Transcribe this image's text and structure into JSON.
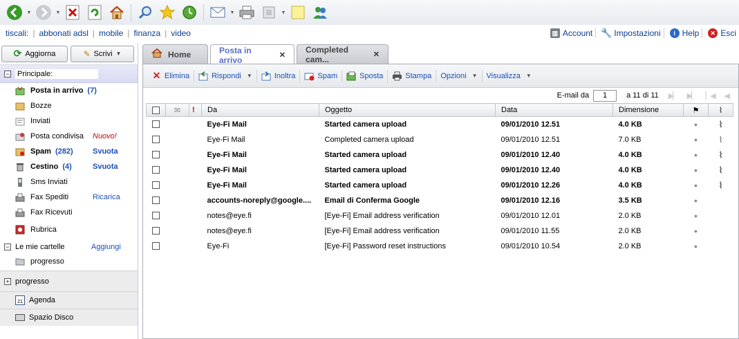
{
  "links": {
    "items": [
      "tiscali:",
      "abbonati adsl",
      "mobile",
      "finanza",
      "video"
    ],
    "account": "Account",
    "settings": "Impostazioni",
    "help": "Help",
    "exit": "Esci"
  },
  "sidebar": {
    "refresh_label": "Aggiorna",
    "compose_label": "Scrivi",
    "section_title": "Principale:",
    "folders": [
      {
        "label": "Posta in arrivo",
        "count": "(7)"
      },
      {
        "label": "Bozze"
      },
      {
        "label": "Inviati"
      },
      {
        "label": "Posta condivisa",
        "tag": "Nuovo!"
      },
      {
        "label": "Spam",
        "count": "(282)",
        "action": "Svuota"
      },
      {
        "label": "Cestino",
        "count": "(4)",
        "action": "Svuota"
      },
      {
        "label": "Sms Inviati"
      },
      {
        "label": "Fax Spediti",
        "action": "Ricarica"
      },
      {
        "label": "Fax Ricevuti"
      },
      {
        "label": "Rubrica"
      }
    ],
    "my_folders_label": "Le mie cartelle",
    "add_label": "Aggiungi",
    "sub_folder": "progresso",
    "bottom_sections": {
      "progresso": "progresso",
      "agenda": "Agenda",
      "agenda_day": "21",
      "disk": "Spazio Disco"
    }
  },
  "tabs": [
    {
      "label": "Home"
    },
    {
      "label": "Posta in arrivo"
    },
    {
      "label": "Completed cam..."
    }
  ],
  "toolbar": {
    "delete": "Elimina",
    "reply": "Rispondi",
    "forward": "Inoltra",
    "spam": "Spam",
    "move": "Sposta",
    "print": "Stampa",
    "options": "Opzioni",
    "view": "Visualizza"
  },
  "pager": {
    "label": "E-mail da",
    "value": "1",
    "range": "a 11 di 11"
  },
  "columns": {
    "from": "Da",
    "subject": "Oggetto",
    "date": "Data",
    "size": "Dimensione"
  },
  "emails": [
    {
      "from": "Eye-Fi Mail",
      "subject": "Started camera upload",
      "date": "09/01/2010 12.51",
      "size": "4.0 KB",
      "unread": true,
      "attachment": true
    },
    {
      "from": "Eye-Fi Mail",
      "subject": "Completed camera upload",
      "date": "09/01/2010 12.51",
      "size": "7.0 KB",
      "unread": false,
      "attachment": true
    },
    {
      "from": "Eye-Fi Mail",
      "subject": "Started camera upload",
      "date": "09/01/2010 12.40",
      "size": "4.0 KB",
      "unread": true,
      "attachment": true
    },
    {
      "from": "Eye-Fi Mail",
      "subject": "Started camera upload",
      "date": "09/01/2010 12.40",
      "size": "4.0 KB",
      "unread": true,
      "attachment": true
    },
    {
      "from": "Eye-Fi Mail",
      "subject": "Started camera upload",
      "date": "09/01/2010 12.26",
      "size": "4.0 KB",
      "unread": true,
      "attachment": true
    },
    {
      "from": "accounts-noreply@google....",
      "subject": "Email di Conferma Google",
      "date": "09/01/2010 12.16",
      "size": "3.5 KB",
      "unread": true,
      "attachment": false
    },
    {
      "from": "notes@eye.fi",
      "subject": "[Eye-Fi] Email address verification",
      "date": "09/01/2010 12.01",
      "size": "2.0 KB",
      "unread": false,
      "attachment": false
    },
    {
      "from": "notes@eye.fi",
      "subject": "[Eye-Fi] Email address verification",
      "date": "09/01/2010 11.55",
      "size": "2.0 KB",
      "unread": false,
      "attachment": false
    },
    {
      "from": "Eye-Fi",
      "subject": "[Eye-Fi] Password reset instructions",
      "date": "09/01/2010 10.54",
      "size": "2.0 KB",
      "unread": false,
      "attachment": false
    }
  ]
}
